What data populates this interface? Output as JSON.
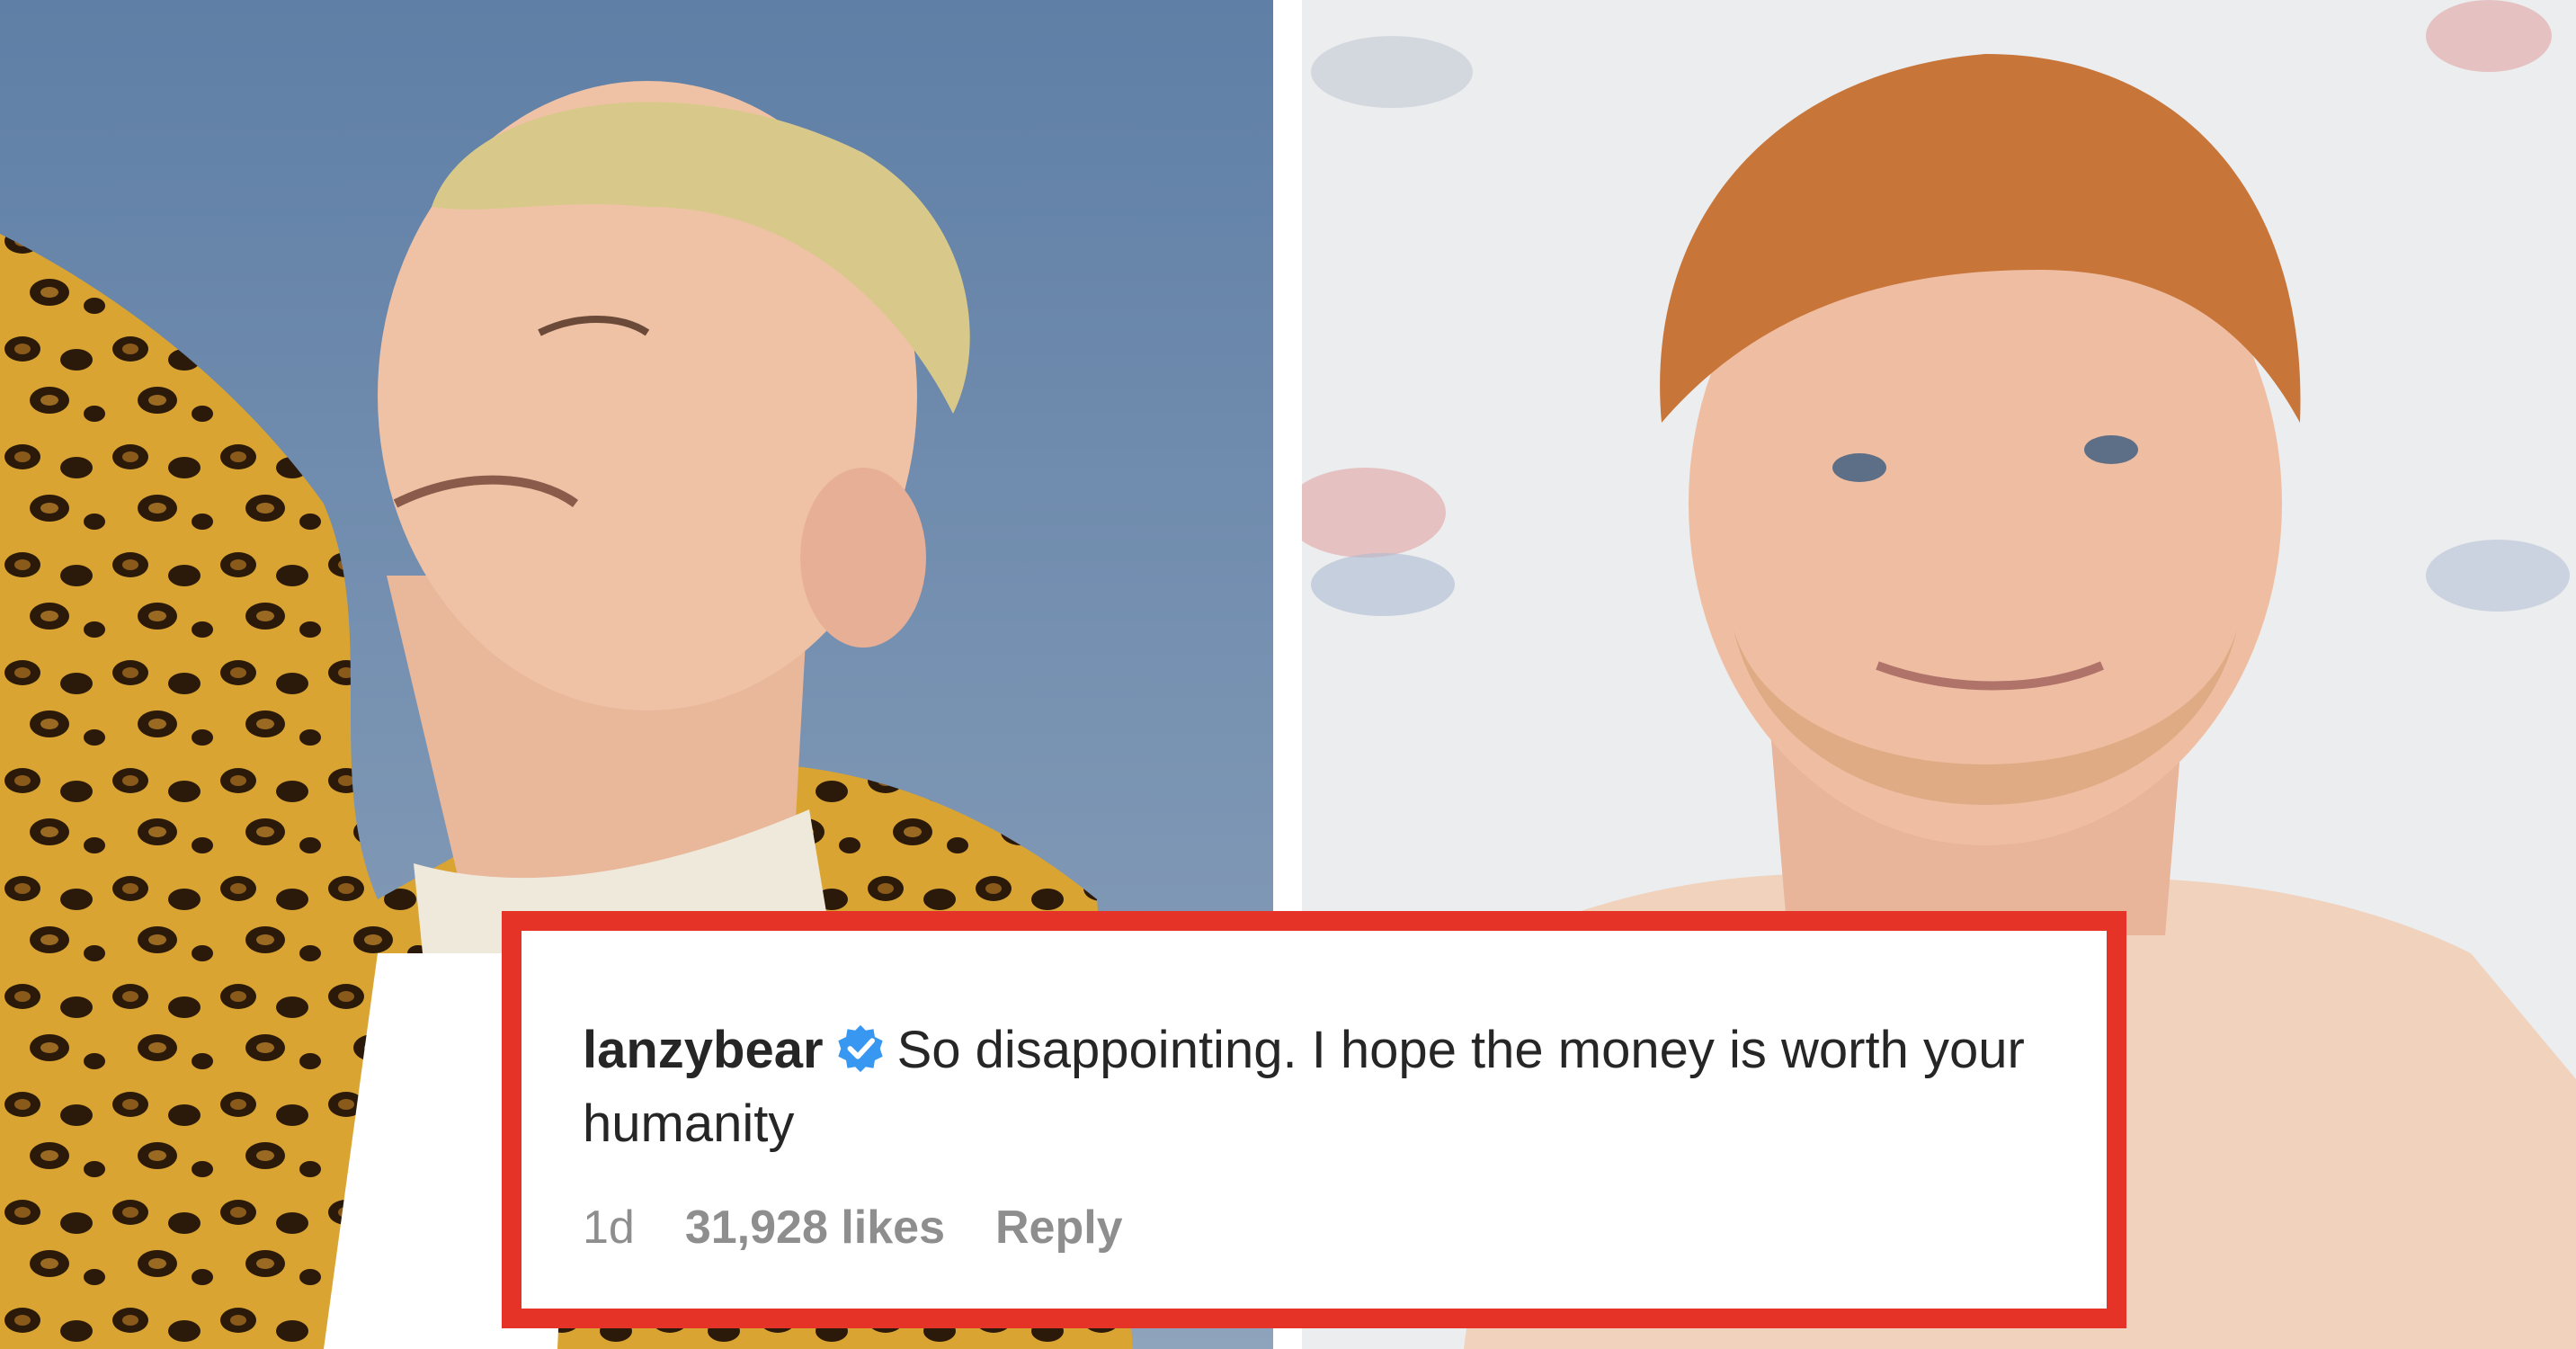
{
  "comment": {
    "username": "lanzybear",
    "verified": true,
    "text": "So disappointing. I hope the money is worth your humanity",
    "time": "1d",
    "likes": "31,928 likes",
    "reply_label": "Reply"
  },
  "colors": {
    "highlight_border": "#e53427",
    "verified_badge": "#3897f0",
    "username_text": "#262626",
    "meta_text": "#8e8e8e"
  },
  "icons": {
    "verified": "verified-badge-icon"
  }
}
